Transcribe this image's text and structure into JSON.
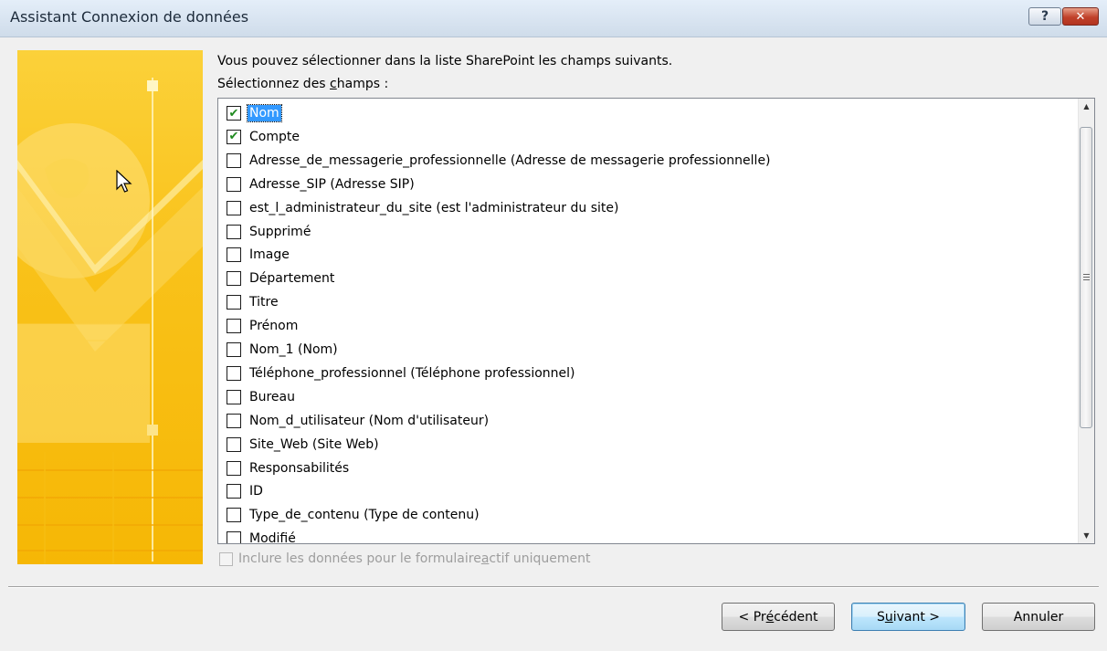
{
  "window": {
    "title": "Assistant Connexion de données",
    "help_glyph": "?",
    "close_glyph": "✕"
  },
  "content": {
    "intro": "Vous pouvez sélectionner dans la liste SharePoint les champs suivants.",
    "select_label_pre": "Sélectionnez des ",
    "select_label_key": "c",
    "select_label_post": "hamps :"
  },
  "fields": [
    {
      "label": "Nom",
      "checked": true
    },
    {
      "label": "Compte",
      "checked": true
    },
    {
      "label": "Adresse_de_messagerie_professionnelle (Adresse de messagerie professionnelle)",
      "checked": false
    },
    {
      "label": "Adresse_SIP (Adresse SIP)",
      "checked": false
    },
    {
      "label": "est_l_administrateur_du_site (est l'administrateur du site)",
      "checked": false
    },
    {
      "label": "Supprimé",
      "checked": false
    },
    {
      "label": "Image",
      "checked": false
    },
    {
      "label": "Département",
      "checked": false
    },
    {
      "label": "Titre",
      "checked": false
    },
    {
      "label": "Prénom",
      "checked": false
    },
    {
      "label": "Nom_1 (Nom)",
      "checked": false
    },
    {
      "label": "Téléphone_professionnel (Téléphone professionnel)",
      "checked": false
    },
    {
      "label": "Bureau",
      "checked": false
    },
    {
      "label": "Nom_d_utilisateur (Nom d'utilisateur)",
      "checked": false
    },
    {
      "label": "Site_Web (Site Web)",
      "checked": false
    },
    {
      "label": "Responsabilités",
      "checked": false
    },
    {
      "label": "ID",
      "checked": false
    },
    {
      "label": "Type_de_contenu (Type de contenu)",
      "checked": false
    },
    {
      "label": "Modifié",
      "checked": false
    }
  ],
  "option": {
    "pre": "Inclure les données pour le formulaire ",
    "key": "a",
    "post": "ctif uniquement",
    "checked": false,
    "enabled": false
  },
  "buttons": {
    "back_pre": "< Pr",
    "back_key": "é",
    "back_post": "cédent",
    "next_pre": "S",
    "next_key": "u",
    "next_post": "ivant >",
    "cancel": "Annuler"
  },
  "scrollbar": {
    "up_glyph": "▲",
    "down_glyph": "▼"
  }
}
